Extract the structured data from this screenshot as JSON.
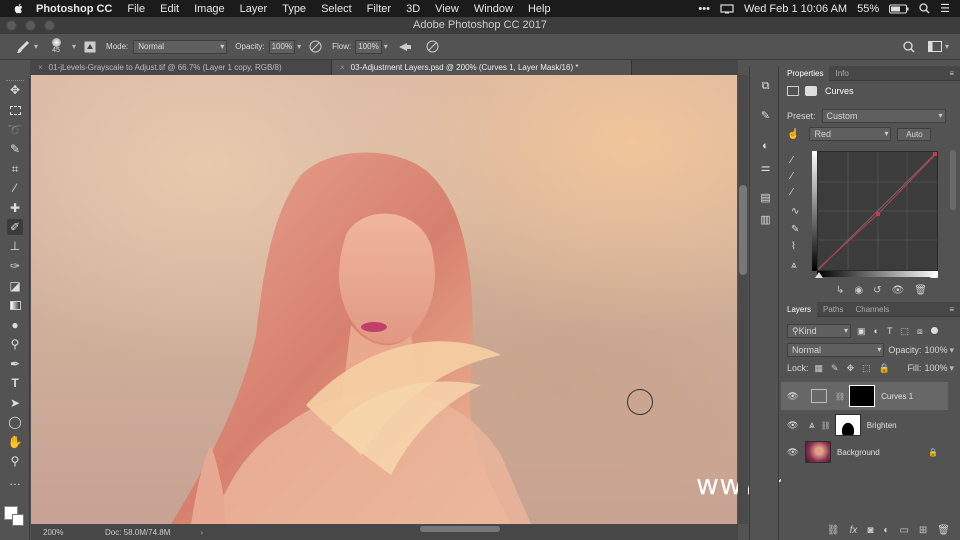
{
  "menubar": {
    "app": "Photoshop CC",
    "items": [
      "File",
      "Edit",
      "Image",
      "Layer",
      "Type",
      "Select",
      "Filter",
      "3D",
      "View",
      "Window",
      "Help"
    ],
    "clock": "Wed Feb 1  10:06 AM",
    "battery": "55%"
  },
  "window": {
    "title": "Adobe Photoshop CC 2017"
  },
  "options": {
    "brush_size": "45",
    "mode_label": "Mode:",
    "mode_value": "Normal",
    "opacity_label": "Opacity:",
    "opacity_value": "100%",
    "flow_label": "Flow:",
    "flow_value": "100%"
  },
  "tabs": [
    {
      "label": "01-jLevels-Grayscale to Adjust.tif @ 66.7% (Layer 1 copy, RGB/8)"
    },
    {
      "label": "03-Adjustment Layers.psd @ 200% (Curves 1, Layer Mask/16) *"
    }
  ],
  "status": {
    "zoom": "200%",
    "doc": "Doc: 58.0M/74.8M"
  },
  "watermark": "www.hunls.com",
  "properties": {
    "tab1": "Properties",
    "tab2": "Info",
    "title": "Curves",
    "preset_label": "Preset:",
    "preset_value": "Custom",
    "channel": "Red",
    "auto": "Auto"
  },
  "layers": {
    "tab1": "Layers",
    "tab2": "Paths",
    "tab3": "Channels",
    "kind": "Kind",
    "blend": "Normal",
    "opacity_label": "Opacity:",
    "opacity_value": "100%",
    "lock_label": "Lock:",
    "fill_label": "Fill:",
    "fill_value": "100%",
    "items": [
      {
        "name": "Curves 1"
      },
      {
        "name": "Brighten"
      },
      {
        "name": "Background"
      }
    ]
  },
  "colors": {
    "accent": "#e0405a",
    "panel": "#535353",
    "menubar": "#1b1b1b"
  }
}
